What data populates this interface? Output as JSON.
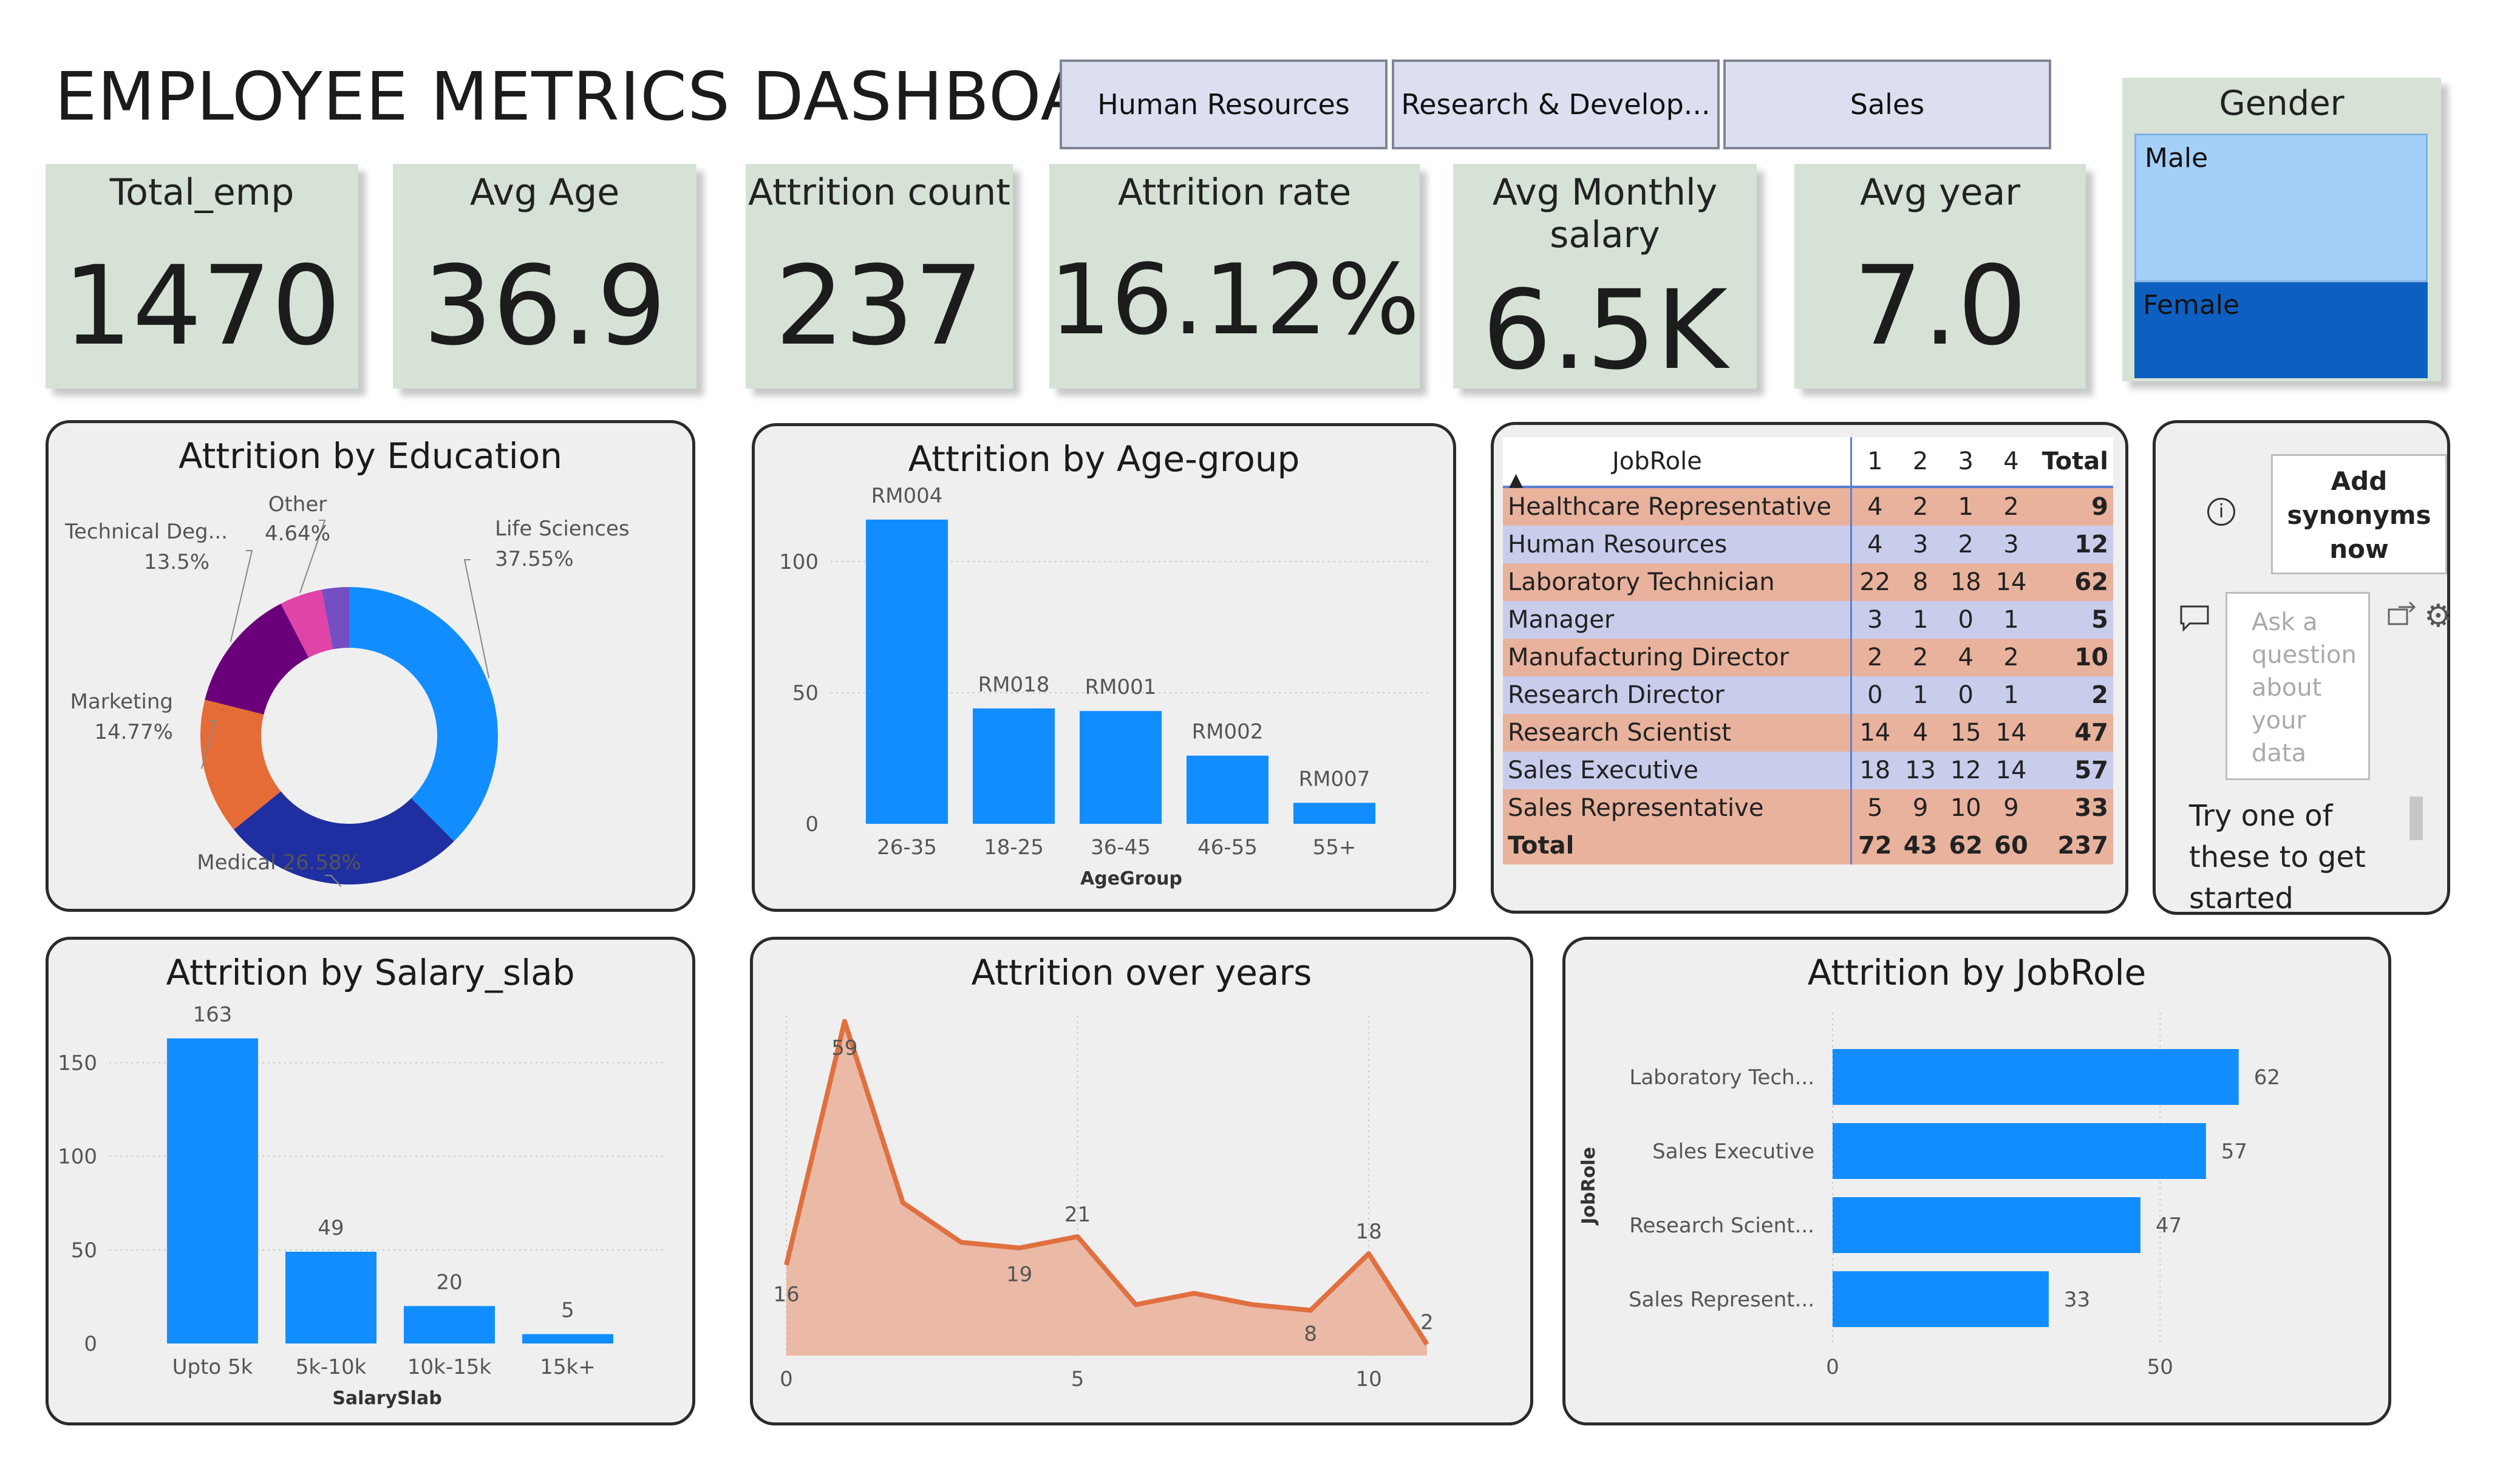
{
  "title": "EMPLOYEE METRICS DASHBOARD",
  "department_slicer": [
    "Human Resources",
    "Research & Develop...",
    "Sales"
  ],
  "kpis": {
    "total_emp": {
      "label": "Total_emp",
      "value": "1470"
    },
    "avg_age": {
      "label": "Avg Age",
      "value": "36.9"
    },
    "attrition_count": {
      "label": "Attrition count",
      "value": "237"
    },
    "attrition_rate": {
      "label": "Attrition rate",
      "value": "16.12%"
    },
    "avg_salary": {
      "label": "Avg Monthly salary",
      "value": "6.5K"
    },
    "avg_year": {
      "label": "Avg year",
      "value": "7.0"
    }
  },
  "gender": {
    "title": "Gender",
    "male": "Male",
    "female": "Female",
    "male_color": "#a4cff8",
    "female_color": "#0e60c0"
  },
  "panels": {
    "education_title": "Attrition by Education",
    "agegroup_title": "Attrition by Age-group",
    "salary_title": "Attrition by Salary_slab",
    "years_title": "Attrition over years",
    "jobrole_title": "Attrition by JobRole"
  },
  "jobrole_table": {
    "headers": [
      "JobRole",
      "1",
      "2",
      "3",
      "4",
      "Total"
    ],
    "rows": [
      [
        "Healthcare Representative",
        "4",
        "2",
        "1",
        "2",
        "9"
      ],
      [
        "Human Resources",
        "4",
        "3",
        "2",
        "3",
        "12"
      ],
      [
        "Laboratory Technician",
        "22",
        "8",
        "18",
        "14",
        "62"
      ],
      [
        "Manager",
        "3",
        "1",
        "0",
        "1",
        "5"
      ],
      [
        "Manufacturing Director",
        "2",
        "2",
        "4",
        "2",
        "10"
      ],
      [
        "Research Director",
        "0",
        "1",
        "0",
        "1",
        "2"
      ],
      [
        "Research Scientist",
        "14",
        "4",
        "15",
        "14",
        "47"
      ],
      [
        "Sales Executive",
        "18",
        "13",
        "12",
        "14",
        "57"
      ],
      [
        "Sales Representative",
        "5",
        "9",
        "10",
        "9",
        "33"
      ]
    ],
    "total": [
      "Total",
      "72",
      "43",
      "62",
      "60",
      "237"
    ],
    "row_colors": [
      "#e8b29d",
      "#c9cdec"
    ]
  },
  "qa": {
    "add_synonyms": "Add synonyms now",
    "placeholder": "Ask a question about your data",
    "hint": "Try one of these to get started"
  },
  "accent_color": "#118dff",
  "chart_data": [
    {
      "id": "education",
      "type": "pie",
      "title": "Attrition by Education",
      "slices": [
        {
          "label": "Life Sciences",
          "value": 37.55,
          "display": "37.55%",
          "color": "#118dff"
        },
        {
          "label": "Medical",
          "value": 26.58,
          "display": "26.58%",
          "color": "#1f2ea0"
        },
        {
          "label": "Marketing",
          "value": 14.77,
          "display": "14.77%",
          "color": "#e66c37"
        },
        {
          "label": "Technical Deg...",
          "value": 13.5,
          "display": "13.5%",
          "color": "#6b007b"
        },
        {
          "label": "Other",
          "value": 4.64,
          "display": "4.64%",
          "color": "#e044a7"
        },
        {
          "label": "",
          "value": 2.96,
          "display": "",
          "color": "#744ec2"
        }
      ]
    },
    {
      "id": "agegroup",
      "type": "bar",
      "title": "Attrition by Age-group",
      "xlabel": "AgeGroup",
      "categories": [
        "26-35",
        "18-25",
        "36-45",
        "46-55",
        "55+"
      ],
      "values": [
        116,
        44,
        43,
        26,
        8
      ],
      "bar_labels": [
        "RM004",
        "RM018",
        "RM001",
        "RM002",
        "RM007"
      ],
      "yticks": [
        0,
        50,
        100
      ],
      "ylim": [
        0,
        125
      ]
    },
    {
      "id": "salary",
      "type": "bar",
      "title": "Attrition by Salary_slab",
      "xlabel": "SalarySlab",
      "categories": [
        "Upto 5k",
        "5k-10k",
        "10k-15k",
        "15k+"
      ],
      "values": [
        163,
        49,
        20,
        5
      ],
      "yticks": [
        0,
        50,
        100,
        150
      ],
      "ylim": [
        0,
        180
      ]
    },
    {
      "id": "years",
      "type": "area",
      "title": "Attrition over years",
      "x": [
        0,
        1,
        2,
        3,
        4,
        5,
        6,
        7,
        8,
        9,
        10,
        11
      ],
      "y": [
        16,
        59,
        27,
        20,
        19,
        21,
        9,
        11,
        9,
        8,
        18,
        2
      ],
      "labeled_points": [
        {
          "x": 0,
          "text": "16"
        },
        {
          "x": 1,
          "text": "59"
        },
        {
          "x": 4,
          "text": "19"
        },
        {
          "x": 5,
          "text": "21"
        },
        {
          "x": 9,
          "text": "8"
        },
        {
          "x": 10,
          "text": "18"
        },
        {
          "x": 11,
          "text": "2"
        }
      ],
      "xticks": [
        0,
        5,
        10
      ],
      "xlim": [
        0,
        11
      ],
      "ylim": [
        0,
        60
      ]
    },
    {
      "id": "jobrole",
      "type": "bar",
      "orientation": "horizontal",
      "title": "Attrition by JobRole",
      "ylabel": "JobRole",
      "categories": [
        "Laboratory Tech...",
        "Sales Executive",
        "Research Scient...",
        "Sales Represent..."
      ],
      "values": [
        62,
        57,
        47,
        33
      ],
      "xticks": [
        0,
        50
      ],
      "xlim": [
        0,
        70
      ]
    }
  ]
}
